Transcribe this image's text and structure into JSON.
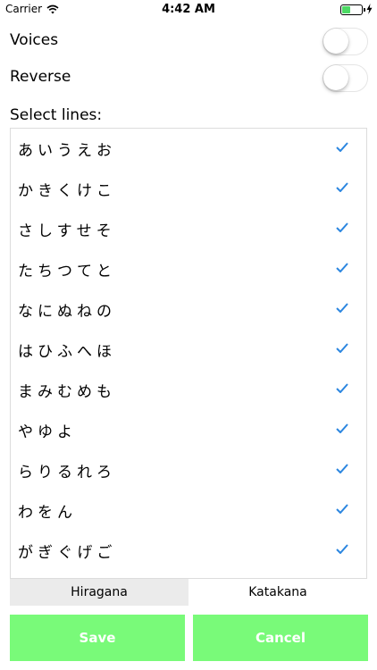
{
  "status_bar": {
    "carrier": "Carrier",
    "time": "4:42 AM",
    "battery_fill": 0.45,
    "battery_color": "#4cd964",
    "icons": [
      "wifi-icon",
      "battery-icon",
      "bolt-icon"
    ]
  },
  "settings": {
    "voices_label": "Voices",
    "voices_on": false,
    "reverse_label": "Reverse",
    "reverse_on": false
  },
  "lines": {
    "title": "Select lines:",
    "check_color": "#2b86e0",
    "items": [
      {
        "label": "あいうえお",
        "checked": true
      },
      {
        "label": "かきくけこ",
        "checked": true
      },
      {
        "label": "さしすせそ",
        "checked": true
      },
      {
        "label": "たちつてと",
        "checked": true
      },
      {
        "label": "なにぬねの",
        "checked": true
      },
      {
        "label": "はひふへほ",
        "checked": true
      },
      {
        "label": "まみむめも",
        "checked": true
      },
      {
        "label": "やゆよ",
        "checked": true
      },
      {
        "label": "らりるれろ",
        "checked": true
      },
      {
        "label": "わをん",
        "checked": true
      },
      {
        "label": "がぎぐげご",
        "checked": true
      }
    ]
  },
  "segments": {
    "items": [
      "Hiragana",
      "Katakana"
    ],
    "selected": "Hiragana"
  },
  "buttons": {
    "save_label": "Save",
    "cancel_label": "Cancel",
    "color": "#79fa79"
  }
}
